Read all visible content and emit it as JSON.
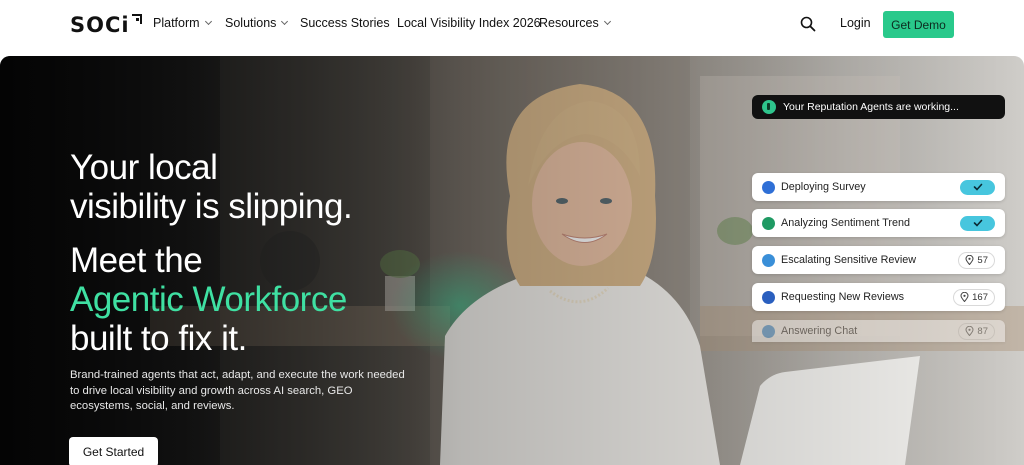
{
  "brand": {
    "logo_text": "SOCi",
    "accent_color": "#29c98b",
    "headline_highlight_color": "#3fe0a2"
  },
  "nav": {
    "items": [
      {
        "label": "Platform",
        "dropdown": true
      },
      {
        "label": "Solutions",
        "dropdown": true
      },
      {
        "label": "Success Stories",
        "dropdown": false
      },
      {
        "label": "Local Visibility Index 2026",
        "dropdown": false
      },
      {
        "label": "Resources",
        "dropdown": true
      }
    ],
    "search_icon": "search-icon",
    "login_label": "Login",
    "demo_label": "Get Demo"
  },
  "hero": {
    "headline_line1": "Your local",
    "headline_line2": "visibility is slipping.",
    "headline_line3": "Meet the",
    "headline_highlight": "Agentic Workforce",
    "headline_line5": "built to fix it.",
    "subtext": "Brand-trained agents that act, adapt, and execute the work needed to drive local visibility and growth across AI search, GEO ecosystems, social, and reviews.",
    "cta_label": "Get Started"
  },
  "agents_panel": {
    "header": "Your Reputation Agents are working...",
    "rows": [
      {
        "label": "Deploying Survey",
        "status": "done",
        "icon_color": "#2f6fd6"
      },
      {
        "label": "Analyzing Sentiment Trend",
        "status": "done",
        "icon_color": "#1f9a63"
      },
      {
        "label": "Escalating Sensitive Review",
        "status": "count",
        "count": "57",
        "icon_color": "#3a8fd8"
      },
      {
        "label": "Requesting New Reviews",
        "status": "count",
        "count": "167",
        "icon_color": "#2a5fbf"
      },
      {
        "label": "Answering Chat",
        "status": "count",
        "count": "87",
        "icon_color": "#3a8fd8"
      }
    ]
  }
}
